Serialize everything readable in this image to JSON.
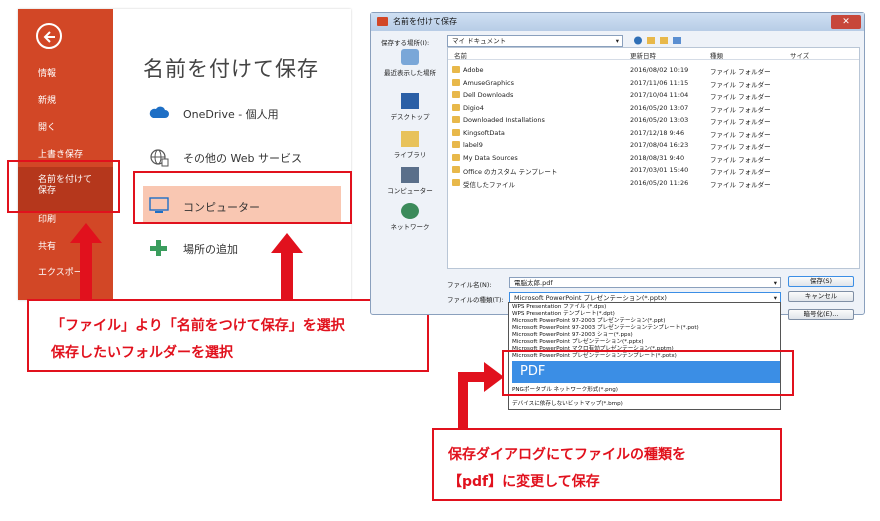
{
  "backstage": {
    "menu": {
      "info": "情報",
      "new": "新規",
      "open": "開く",
      "save": "上書き保存",
      "saveas_line1": "名前を付けて",
      "saveas_line2": "保存",
      "print": "印刷",
      "share": "共有",
      "export": "エクスポート"
    },
    "title": "名前を付けて保存",
    "locations": [
      {
        "label": "OneDrive - 個人用",
        "icon": "cloud-icon"
      },
      {
        "label": "その他の Web サービス",
        "icon": "globe-icon"
      },
      {
        "label": "コンピューター",
        "icon": "computer-icon"
      },
      {
        "label": "場所の追加",
        "icon": "plus-icon"
      }
    ],
    "accent": "#d24726",
    "selected_bg": "#f9c7b2"
  },
  "dialog": {
    "title": "名前を付けて保存",
    "save_in_label": "保存する場所(I):",
    "save_in_value": "マイ ドキュメント",
    "columns": [
      "名前",
      "更新日時",
      "種類",
      "サイズ"
    ],
    "places": [
      "最近表示した場所",
      "デスクトップ",
      "ライブラリ",
      "コンピューター",
      "ネットワーク"
    ],
    "files": [
      {
        "name": "Adobe",
        "date": "2016/08/02 10:19",
        "type": "ファイル フォルダー"
      },
      {
        "name": "AmuseGraphics",
        "date": "2017/11/06 11:15",
        "type": "ファイル フォルダー"
      },
      {
        "name": "Dell Downloads",
        "date": "2017/10/04 11:04",
        "type": "ファイル フォルダー"
      },
      {
        "name": "Digio4",
        "date": "2016/05/20 13:07",
        "type": "ファイル フォルダー"
      },
      {
        "name": "Downloaded Installations",
        "date": "2016/05/20 13:03",
        "type": "ファイル フォルダー"
      },
      {
        "name": "KingsoftData",
        "date": "2017/12/18 9:46",
        "type": "ファイル フォルダー"
      },
      {
        "name": "label9",
        "date": "2017/08/04 16:23",
        "type": "ファイル フォルダー"
      },
      {
        "name": "My Data Sources",
        "date": "2018/08/31 9:40",
        "type": "ファイル フォルダー"
      },
      {
        "name": "Office のカスタム テンプレート",
        "date": "2017/03/01 15:40",
        "type": "ファイル フォルダー"
      },
      {
        "name": "受信したファイル",
        "date": "2016/05/20 11:26",
        "type": "ファイル フォルダー"
      }
    ],
    "filename_label": "ファイル名(N):",
    "filename_value": "電脳太郎.pdf",
    "filetype_label": "ファイルの種類(T):",
    "filetype_value": "Microsoft PowerPoint プレゼンテーション(*.pptx)",
    "save_button": "保存(S)",
    "cancel_button": "キャンセル",
    "encrypt_button": "暗号化(E)...",
    "type_options": [
      "WPS Presentation ファイル (*.dps)",
      "WPS Presentation テンプレート(*.dpt)",
      "Microsoft PowerPoint 97-2003 プレゼンテーション(*.ppt)",
      "Microsoft PowerPoint 97-2003 プレゼンテーションテンプレート(*.pot)",
      "Microsoft PowerPoint 97-2003 ショー(*.pps)",
      "Microsoft PowerPoint プレゼンテーション(*.pptx)",
      "Microsoft PowerPoint マクロ有効プレゼンテーション(*.pptm)",
      "Microsoft PowerPoint プレゼンテーションテンプレート(*.potx)"
    ],
    "pdf_option": "PDF",
    "type_options_after": [
      "PNGポータブル ネットワーク形式(*.png)",
      "デバイスに依存しないビットマップ(*.bmp)"
    ]
  },
  "callouts": {
    "left_line1": "「ファイル」より「名前をつけて保存」を選択",
    "left_line2": "保存したいフォルダーを選択",
    "right_line1": "保存ダイアログにてファイルの種類を",
    "right_line2": "【pdf】に変更して保存",
    "color": "#e1111d"
  }
}
